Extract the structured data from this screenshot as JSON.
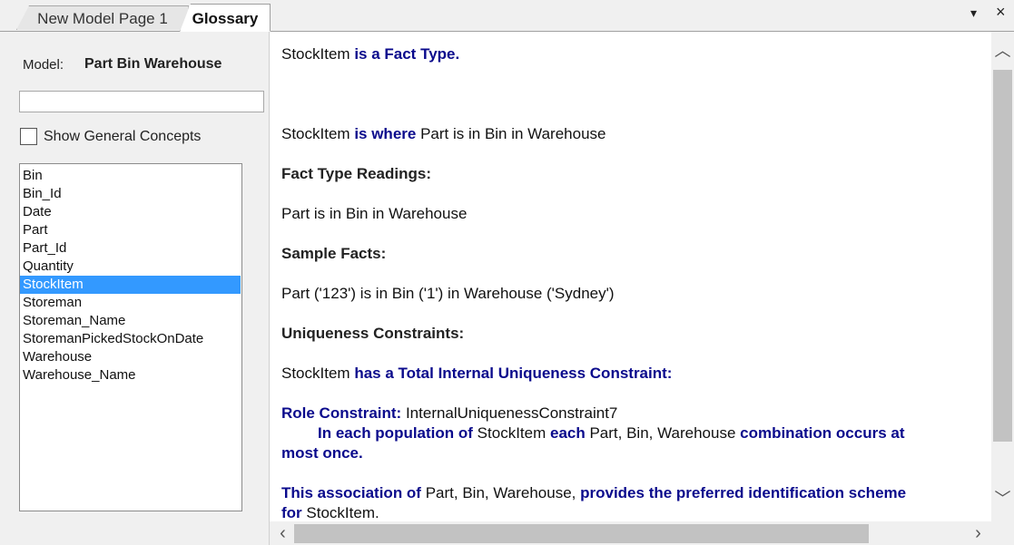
{
  "tabs": [
    {
      "label": "New Model Page 1"
    },
    {
      "label": "Glossary"
    }
  ],
  "tab_controls": {
    "dropdown": "▾",
    "close": "×"
  },
  "sidebar": {
    "model_label": "Model:",
    "model_name": "Part Bin Warehouse",
    "search_value": "",
    "show_general_label": "Show General Concepts",
    "show_general_checked": false,
    "items": [
      {
        "label": "Bin"
      },
      {
        "label": "Bin_Id"
      },
      {
        "label": "Date"
      },
      {
        "label": "Part"
      },
      {
        "label": "Part_Id"
      },
      {
        "label": "Quantity"
      },
      {
        "label": "StockItem"
      },
      {
        "label": "Storeman"
      },
      {
        "label": "Storeman_Name"
      },
      {
        "label": "StoremanPickedStockOnDate"
      },
      {
        "label": "Warehouse"
      },
      {
        "label": "Warehouse_Name"
      }
    ],
    "selected_index": 6
  },
  "content": {
    "l1a": "StockItem ",
    "l1b": "is a Fact Type.",
    "l2a": "StockItem ",
    "l2b": "is where",
    "l2c": " Part is in Bin in Warehouse",
    "h_readings": "Fact Type Readings:",
    "reading": "Part is in Bin in Warehouse",
    "h_samples": "Sample Facts:",
    "sample": "Part ('123') is in Bin ('1') in Warehouse ('Sydney')",
    "h_uc": "Uniqueness Constraints:",
    "uc_a": "StockItem ",
    "uc_b": "has a Total Internal Uniqueness Constraint:",
    "rc_a": "Role Constraint:",
    "rc_b": " InternalUniquenessConstraint7",
    "in_a": "In each population of",
    "in_b": " StockItem ",
    "in_c": "each",
    "in_d": " Part, Bin, Warehouse ",
    "in_e": "combination occurs at",
    "in_f": "most once.",
    "as_a": "This association of",
    "as_b": " Part, Bin, Warehouse, ",
    "as_c": "provides the preferred identification scheme",
    "as_d": "for",
    "as_e": " StockItem."
  },
  "scroll": {
    "up": "︿",
    "down": "﹀",
    "left": "‹",
    "right": "›"
  },
  "colors": {
    "accent_text": "#0a0a8c",
    "selection": "#3399ff"
  }
}
